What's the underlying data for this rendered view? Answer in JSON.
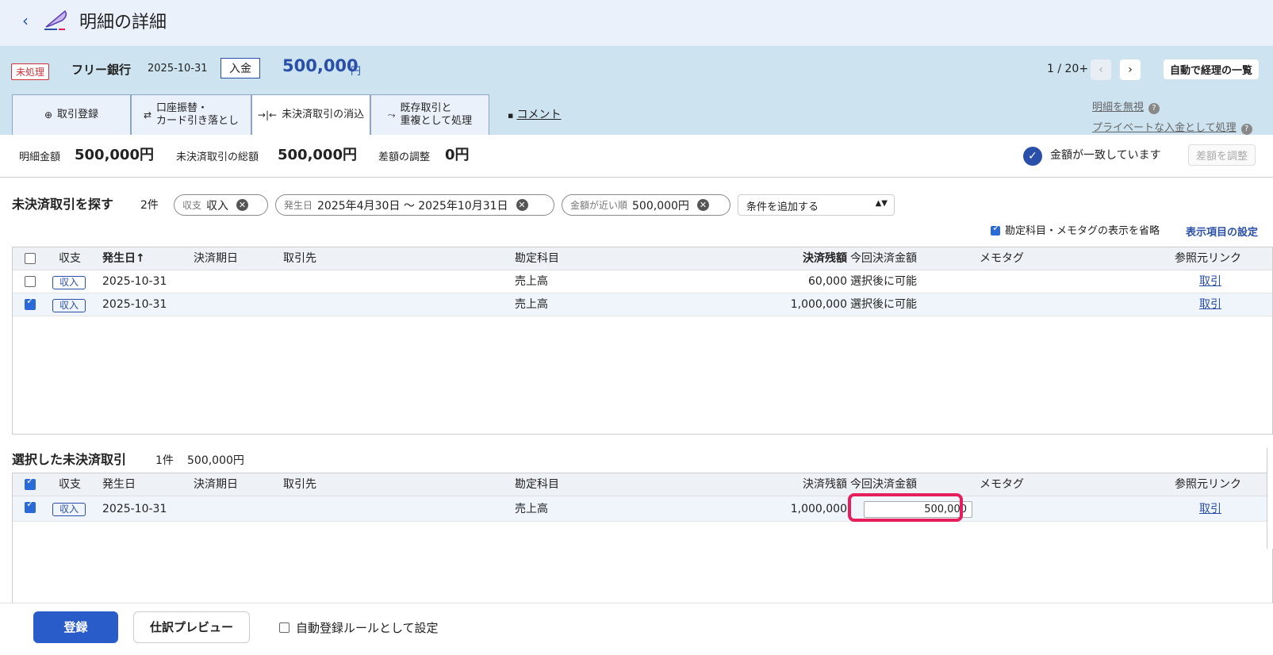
{
  "header": {
    "title": "明細の詳細",
    "back_icon": "chevron-left-icon",
    "logo_icon": "quill-logo-icon"
  },
  "statement": {
    "status_badge": "未処理",
    "bank": "フリー銀行",
    "date": "2025-10-31",
    "direction": "入金",
    "amount": "500,000",
    "amount_unit": "円",
    "pager": "1 / 20+",
    "auto_list_label": "自動で経理の一覧"
  },
  "tabs": [
    {
      "icon": "⊕",
      "label": "取引登録"
    },
    {
      "icon": "⇄",
      "label": "口座振替・\nカード引き落とし"
    },
    {
      "icon": "→|←",
      "label": "未決済取引の消込"
    },
    {
      "icon": "⤳",
      "label": "既存取引と\n重複として処理"
    }
  ],
  "comment_label": "コメント",
  "side_links": {
    "ignore": "明細を無視",
    "private": "プライベートな入金として処理"
  },
  "summary": {
    "statement_amount_label": "明細金額",
    "statement_amount": "500,000円",
    "unsettled_total_label": "未決済取引の総額",
    "unsettled_total": "500,000円",
    "diff_label": "差額の調整",
    "diff": "0円",
    "match_text": "金額が一致しています",
    "adjust_label": "差額を調整"
  },
  "search": {
    "title": "未決済取引を探す",
    "count": "2件",
    "chips": [
      {
        "key": "収支",
        "value": "収入"
      },
      {
        "key": "発生日",
        "value": "2025年4月30日 〜 2025年10月31日"
      },
      {
        "key": "金額が近い順",
        "value": "500,000円"
      }
    ],
    "add_condition": "条件を追加する",
    "omit_label": "勘定科目・メモタグの表示を省略",
    "display_settings": "表示項目の設定"
  },
  "columns": {
    "kind": "収支",
    "date": "発生日",
    "date_sorted": "発生日↑",
    "due": "決済期日",
    "partner": "取引先",
    "account": "勘定科目",
    "balance": "決済残額",
    "this_amount": "今回決済金額",
    "memo": "メモタグ",
    "ref": "参照元リンク"
  },
  "search_rows": [
    {
      "checked": false,
      "kind": "収入",
      "date": "2025-10-31",
      "account": "売上高",
      "balance": "60,000",
      "this_amount": "選択後に可能",
      "ref": "取引"
    },
    {
      "checked": true,
      "kind": "収入",
      "date": "2025-10-31",
      "account": "売上高",
      "balance": "1,000,000",
      "this_amount": "選択後に可能",
      "ref": "取引"
    }
  ],
  "selected": {
    "title": "選択した未決済取引",
    "count": "1件",
    "total": "500,000円",
    "rows": [
      {
        "checked": true,
        "kind": "収入",
        "date": "2025-10-31",
        "account": "売上高",
        "balance": "1,000,000",
        "this_amount": "500,000",
        "ref": "取引"
      }
    ]
  },
  "footer": {
    "register": "登録",
    "preview": "仕訳プレビュー",
    "auto_rule": "自動登録ルールとして設定"
  },
  "colors": {
    "accent": "#2a4fa8",
    "band": "#cde4f0",
    "highlight": "#e61e5b"
  }
}
